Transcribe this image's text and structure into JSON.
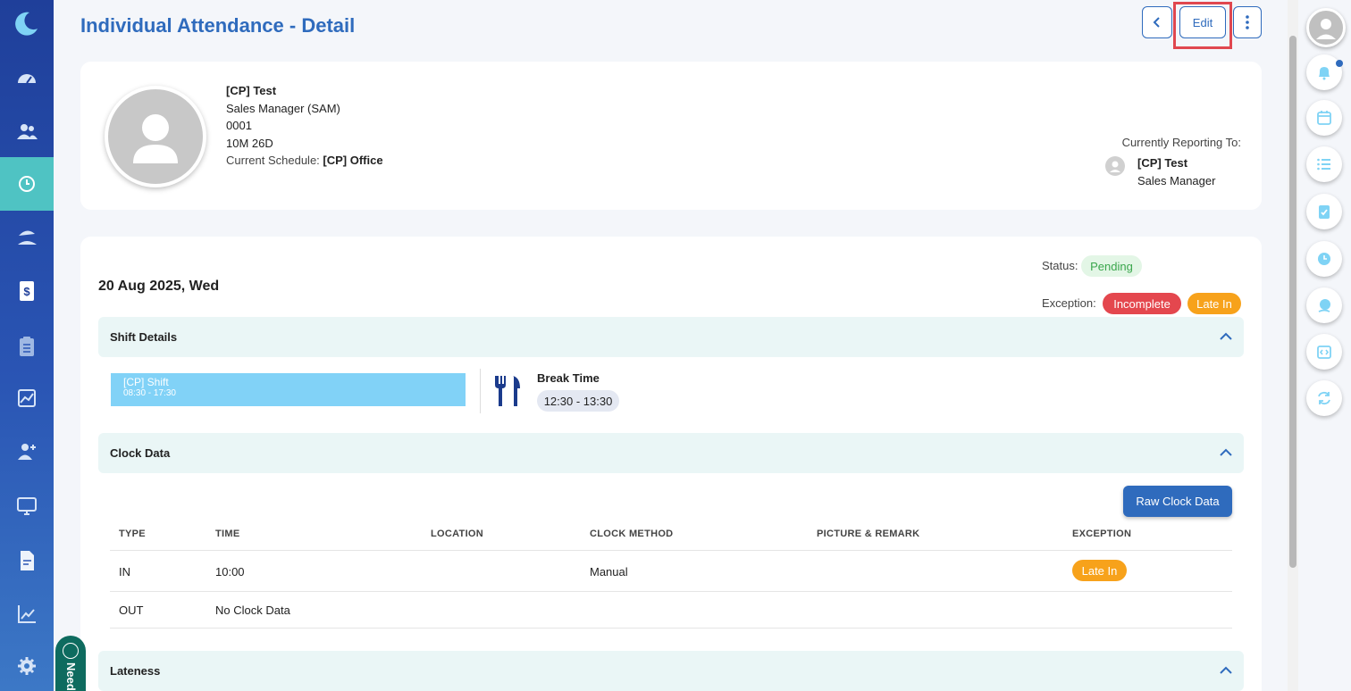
{
  "page": {
    "title": "Individual Attendance - Detail",
    "edit_label": "Edit"
  },
  "sidebar": {
    "items": [
      {
        "icon": "dashboard-icon"
      },
      {
        "icon": "employees-icon"
      },
      {
        "icon": "attendance-clock-icon",
        "active": true
      },
      {
        "icon": "leave-beach-icon"
      },
      {
        "icon": "payroll-dollar-icon"
      },
      {
        "icon": "clipboard-icon"
      },
      {
        "icon": "analytics-icon"
      },
      {
        "icon": "add-user-icon"
      },
      {
        "icon": "monitor-icon"
      },
      {
        "icon": "document-icon"
      },
      {
        "icon": "report-chart-icon"
      },
      {
        "icon": "settings-gear-icon"
      }
    ]
  },
  "employee": {
    "name": "[CP] Test",
    "position": "Sales Manager (SAM)",
    "id": "0001",
    "tenure": "10M 26D",
    "schedule_label": "Current Schedule:",
    "schedule_value": "[CP] Office"
  },
  "reporting": {
    "label": "Currently Reporting To:",
    "name": "[CP] Test",
    "role": "Sales Manager"
  },
  "detail": {
    "date": "20 Aug 2025, Wed",
    "status_label": "Status:",
    "status_value": "Pending",
    "exception_label": "Exception:",
    "exceptions": [
      "Incomplete",
      "Late In"
    ],
    "colors": {
      "pending_bg": "#e3f6e6",
      "incomplete": "#e4474e",
      "late_in": "#f7a21b",
      "accent": "#2f6bbd"
    }
  },
  "shift": {
    "section_title": "Shift Details",
    "name": "[CP] Shift",
    "time": "08:30 - 17:30",
    "break_title": "Break Time",
    "break_time": "12:30 - 13:30"
  },
  "clock": {
    "section_title": "Clock Data",
    "raw_button": "Raw Clock Data",
    "columns": [
      "TYPE",
      "TIME",
      "LOCATION",
      "CLOCK METHOD",
      "PICTURE & REMARK",
      "EXCEPTION"
    ],
    "rows": [
      {
        "type": "IN",
        "time": "10:00",
        "location": "",
        "method": "Manual",
        "remark": "",
        "exception": "Late In"
      },
      {
        "type": "OUT",
        "time": "No Clock Data",
        "location": "",
        "method": "",
        "remark": "",
        "exception": ""
      }
    ]
  },
  "lateness": {
    "section_title": "Lateness"
  },
  "help": {
    "label": "Need"
  }
}
